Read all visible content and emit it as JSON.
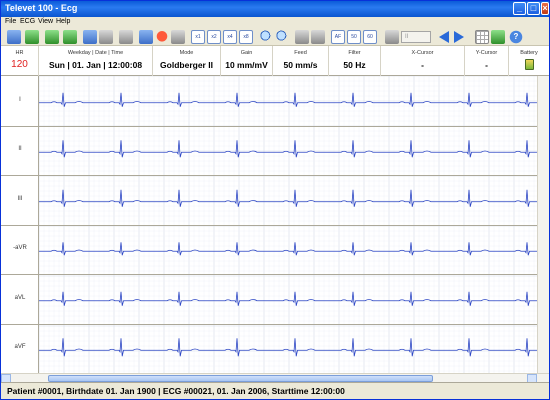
{
  "window": {
    "title": "Televet 100 - Ecg"
  },
  "menu": [
    "File",
    "ECG",
    "View",
    "Help"
  ],
  "toolbar": {
    "filter_buttons": [
      "AF",
      "50",
      "60"
    ],
    "speed_buttons": [
      "x1",
      "x2",
      "x4",
      "x8"
    ],
    "select_value": "II"
  },
  "status": {
    "hr_label": "HR",
    "hr_value": "120",
    "datetime_label": "Weekday | Date | Time",
    "datetime_value": "Sun | 01. Jan | 12:00:08",
    "mode_label": "Mode",
    "mode_value": "Goldberger II",
    "gain_label": "Gain",
    "gain_value": "10 mm/mV",
    "feed_label": "Feed",
    "feed_value": "50 mm/s",
    "filter_label": "Filter",
    "filter_value": "50 Hz",
    "xcursor_label": "X-Cursor",
    "xcursor_value": "-",
    "ycursor_label": "Y-Cursor",
    "ycursor_value": "-",
    "battery_label": "Battery"
  },
  "leads": [
    "I",
    "II",
    "III",
    "-aVR",
    "aVL",
    "aVF"
  ],
  "colors": {
    "trace": "#2b45c4",
    "grid_minor": "#eceff7",
    "grid_major": "#d6dbea"
  },
  "footer": {
    "info": "Patient #0001, Birthdate 01. Jan 1900 | ECG #00021, 01. Jan 2006, Starttime 12:00:00"
  }
}
